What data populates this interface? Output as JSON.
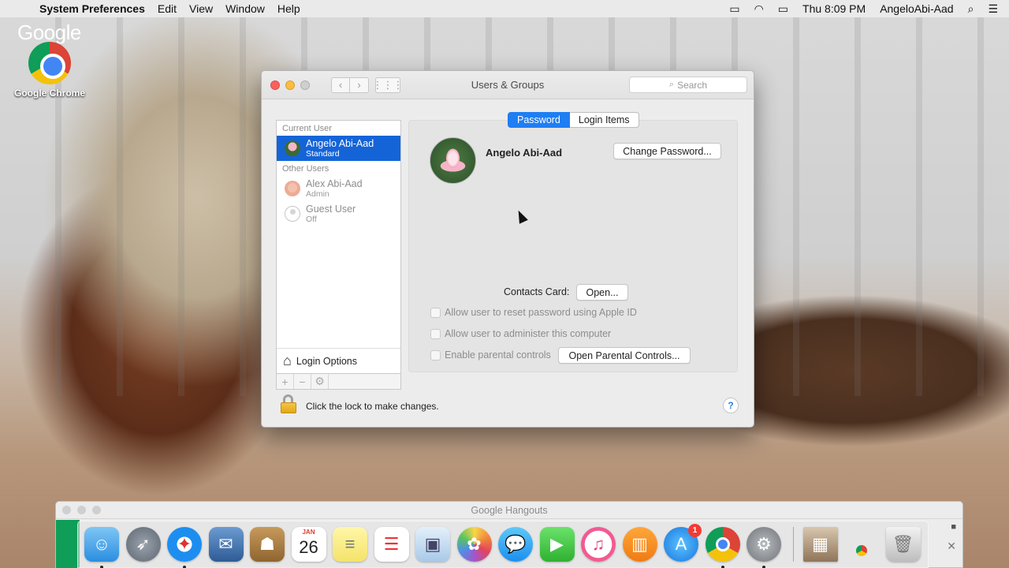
{
  "menubar": {
    "app_name": "System Preferences",
    "menus": [
      "Edit",
      "View",
      "Window",
      "Help"
    ],
    "clock": "Thu 8:09 PM",
    "user": "AngeloAbi-Aad"
  },
  "desktop": {
    "chrome_label": "Google Chrome",
    "google_word": "Google"
  },
  "window": {
    "title": "Users & Groups",
    "search_placeholder": "Search",
    "tabs": [
      "Password",
      "Login Items"
    ],
    "sidebar": {
      "current_user_header": "Current User",
      "current_user": {
        "name": "Angelo Abi-Aad",
        "role": "Standard"
      },
      "other_users_header": "Other Users",
      "other_users": [
        {
          "name": "Alex Abi-Aad",
          "role": "Admin"
        },
        {
          "name": "Guest User",
          "role": "Off"
        }
      ],
      "login_options": "Login Options",
      "actions": [
        "+",
        "−",
        "⚙"
      ]
    },
    "detail": {
      "user_name": "Angelo Abi-Aad",
      "change_password": "Change Password...",
      "contacts_label": "Contacts Card:",
      "open_button": "Open...",
      "checkboxes": [
        "Allow user to reset password using Apple ID",
        "Allow user to administer this computer",
        "Enable parental controls"
      ],
      "open_parental": "Open Parental Controls..."
    },
    "lock_text": "Click the lock to make changes.",
    "help": "?"
  },
  "hangouts": {
    "title": "Google Hangouts"
  },
  "dock": {
    "calendar_month": "JAN",
    "calendar_day": "26",
    "app_store_badge": "1"
  }
}
